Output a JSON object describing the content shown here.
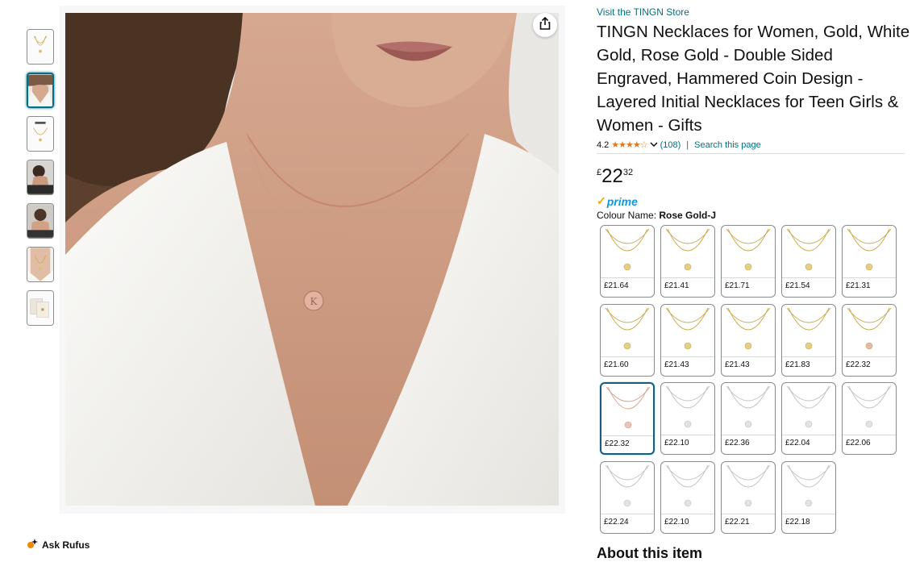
{
  "product": {
    "store_link": "Visit the TINGN Store",
    "title": "TINGN Necklaces for Women, Gold, White Gold, Rose Gold - Double Sided Engraved, Hammered Coin Design - Layered Initial Necklaces for Teen Girls & Women - Gifts",
    "rating": "4.2",
    "stars_icon": "star-rating-4-half",
    "review_count": "(108)",
    "search_page": "Search this page",
    "price": {
      "symbol": "£",
      "whole": "22",
      "fraction": "32"
    },
    "prime_label": "prime",
    "colour_label": "Colour Name:",
    "colour_value": "Rose Gold-J",
    "about_heading": "About this item"
  },
  "rufus": {
    "label": "Ask Rufus"
  },
  "thumbnails": [
    {
      "name": "thumb-1-gold-necklace"
    },
    {
      "name": "thumb-2-model",
      "selected": true
    },
    {
      "name": "thumb-3-package"
    },
    {
      "name": "thumb-4-model-side"
    },
    {
      "name": "thumb-5-model-portrait"
    },
    {
      "name": "thumb-6-model-closeup"
    },
    {
      "name": "thumb-7-cards"
    }
  ],
  "swatches": [
    {
      "price": "£21.64",
      "metal": "gold"
    },
    {
      "price": "£21.41",
      "metal": "gold"
    },
    {
      "price": "£21.71",
      "metal": "gold"
    },
    {
      "price": "£21.54",
      "metal": "gold"
    },
    {
      "price": "£21.31",
      "metal": "gold"
    },
    {
      "price": "£21.60",
      "metal": "gold"
    },
    {
      "price": "£21.43",
      "metal": "gold"
    },
    {
      "price": "£21.43",
      "metal": "gold"
    },
    {
      "price": "£21.83",
      "metal": "gold"
    },
    {
      "price": "£22.32",
      "metal": "gold-rose"
    },
    {
      "price": "£22.32",
      "metal": "rose",
      "selected": true
    },
    {
      "price": "£22.10",
      "metal": "silver"
    },
    {
      "price": "£22.36",
      "metal": "silver"
    },
    {
      "price": "£22.04",
      "metal": "silver"
    },
    {
      "price": "£22.06",
      "metal": "silver"
    },
    {
      "price": "£22.24",
      "metal": "silver"
    },
    {
      "price": "£22.10",
      "metal": "silver"
    },
    {
      "price": "£22.21",
      "metal": "silver"
    },
    {
      "price": "£22.18",
      "metal": "silver"
    }
  ],
  "colors": {
    "link": "#007185",
    "star": "#de7921",
    "prime_blue": "#1399d6",
    "prime_check": "#f7a600",
    "selected_border": "#1e5a7a",
    "gold": "#c9a94e",
    "rose": "#d6a08f",
    "silver": "#bfc3c7"
  }
}
